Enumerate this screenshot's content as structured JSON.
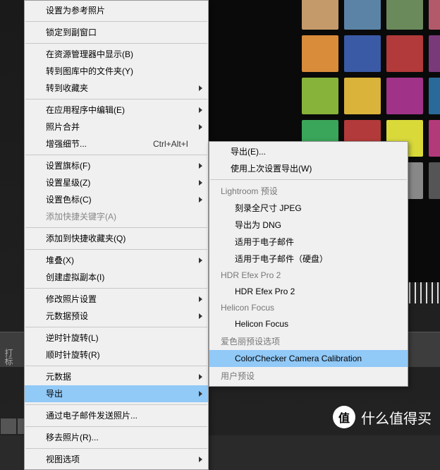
{
  "swatches": [
    "#c59a6a",
    "#5b83a6",
    "#6a8a5b",
    "#b35a6a",
    "#d98c3a",
    "#3a5aa6",
    "#b33a3a",
    "#7a3a7a",
    "#88b33a",
    "#d9b33a",
    "#a03388",
    "#2a6a9a",
    "#3aa65a",
    "#b33a3a",
    "#d9d93a",
    "#b33a7a",
    "#f0f0f0",
    "#c0c0c0",
    "#888888",
    "#555555"
  ],
  "main_menu": [
    {
      "type": "item",
      "label": "设置为参考照片"
    },
    {
      "type": "sep"
    },
    {
      "type": "item",
      "label": "锁定到副窗口"
    },
    {
      "type": "sep"
    },
    {
      "type": "item",
      "label": "在资源管理器中显示(B)"
    },
    {
      "type": "item",
      "label": "转到图库中的文件夹(Y)"
    },
    {
      "type": "item",
      "label": "转到收藏夹",
      "sub": true
    },
    {
      "type": "sep"
    },
    {
      "type": "item",
      "label": "在应用程序中编辑(E)",
      "sub": true
    },
    {
      "type": "item",
      "label": "照片合并",
      "sub": true
    },
    {
      "type": "item",
      "label": "增强细节...",
      "shortcut": "Ctrl+Alt+I"
    },
    {
      "type": "sep"
    },
    {
      "type": "item",
      "label": "设置旗标(F)",
      "sub": true
    },
    {
      "type": "item",
      "label": "设置星级(Z)",
      "sub": true
    },
    {
      "type": "item",
      "label": "设置色标(C)",
      "sub": true
    },
    {
      "type": "item",
      "label": "添加快捷关键字(A)",
      "disabled": true
    },
    {
      "type": "sep"
    },
    {
      "type": "item",
      "label": "添加到快捷收藏夹(Q)"
    },
    {
      "type": "sep"
    },
    {
      "type": "item",
      "label": "堆叠(X)",
      "sub": true
    },
    {
      "type": "item",
      "label": "创建虚拟副本(I)"
    },
    {
      "type": "sep"
    },
    {
      "type": "item",
      "label": "修改照片设置",
      "sub": true
    },
    {
      "type": "item",
      "label": "元数据预设",
      "sub": true
    },
    {
      "type": "sep"
    },
    {
      "type": "item",
      "label": "逆时针旋转(L)"
    },
    {
      "type": "item",
      "label": "顺时针旋转(R)"
    },
    {
      "type": "sep"
    },
    {
      "type": "item",
      "label": "元数据",
      "sub": true
    },
    {
      "type": "item",
      "label": "导出",
      "sub": true,
      "highlighted": true
    },
    {
      "type": "sep"
    },
    {
      "type": "item",
      "label": "通过电子邮件发送照片..."
    },
    {
      "type": "sep"
    },
    {
      "type": "item",
      "label": "移去照片(R)..."
    },
    {
      "type": "sep"
    },
    {
      "type": "item",
      "label": "视图选项",
      "sub": true
    }
  ],
  "sub_menu": [
    {
      "type": "item",
      "label": "导出(E)..."
    },
    {
      "type": "item",
      "label": "使用上次设置导出(W)"
    },
    {
      "type": "sep"
    },
    {
      "type": "header",
      "label": "Lightroom 预设"
    },
    {
      "type": "subitem",
      "label": "刻录全尺寸 JPEG"
    },
    {
      "type": "subitem",
      "label": "导出为 DNG"
    },
    {
      "type": "subitem",
      "label": "适用于电子邮件"
    },
    {
      "type": "subitem",
      "label": "适用于电子邮件（硬盘）"
    },
    {
      "type": "header",
      "label": "HDR Efex Pro 2"
    },
    {
      "type": "subitem",
      "label": "HDR Efex Pro 2"
    },
    {
      "type": "header",
      "label": "Helicon Focus"
    },
    {
      "type": "subitem",
      "label": "Helicon Focus"
    },
    {
      "type": "header",
      "label": "爱色丽预设选项"
    },
    {
      "type": "subitem",
      "label": "ColorChecker Camera Calibration",
      "highlighted": true
    },
    {
      "type": "header",
      "label": "用户预设"
    }
  ],
  "watermark": {
    "badge": "值",
    "text": "什么值得买"
  },
  "cut_label": "打标"
}
